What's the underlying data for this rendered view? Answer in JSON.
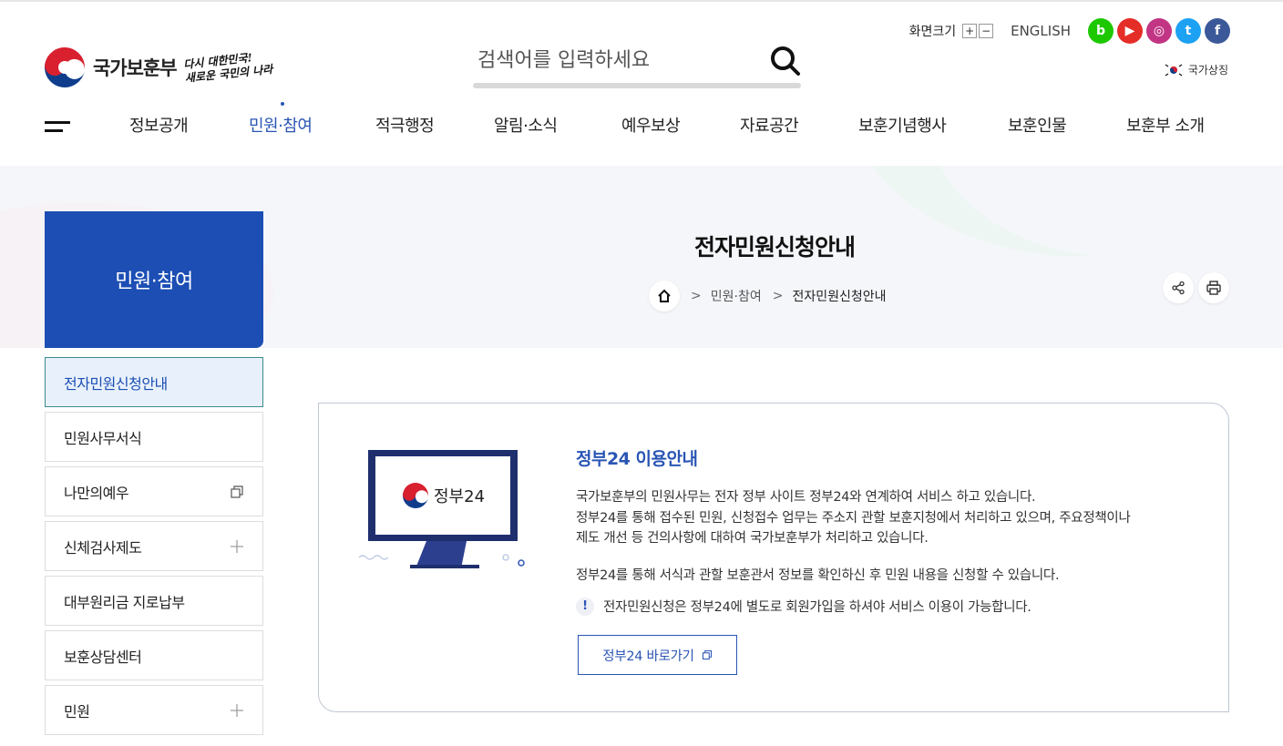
{
  "header": {
    "logo_text": "국가보훈부",
    "slogan_line1": "다시 대한민국!",
    "slogan_line2": "새로운 국민의 나라",
    "search_placeholder": "검색어를 입력하세요",
    "font_size_label": "화면크기",
    "font_plus": "+",
    "font_minus": "−",
    "english": "ENGLISH",
    "sns": [
      {
        "name": "blog",
        "glyph": "b",
        "color": "#1ec800"
      },
      {
        "name": "youtube",
        "glyph": "▶",
        "color": "#e52d27"
      },
      {
        "name": "instagram",
        "glyph": "◎",
        "color": "#c13584"
      },
      {
        "name": "twitter",
        "glyph": "t",
        "color": "#1da1f2"
      },
      {
        "name": "facebook",
        "glyph": "f",
        "color": "#3b5998"
      }
    ],
    "national_symbol": "국가상징"
  },
  "gnb": {
    "items": [
      "정보공개",
      "민원·참여",
      "적극행정",
      "알림·소식",
      "예우보상",
      "자료공간",
      "보훈기념행사",
      "보훈인물",
      "보훈부 소개"
    ],
    "active_index": 1
  },
  "side": {
    "title": "민원·참여",
    "items": [
      {
        "label": "전자민원신청안내",
        "mark": "none"
      },
      {
        "label": "민원사무서식",
        "mark": "none"
      },
      {
        "label": "나만의예우",
        "mark": "new-window"
      },
      {
        "label": "신체검사제도",
        "mark": "plus"
      },
      {
        "label": "대부원리금 지로납부",
        "mark": "none"
      },
      {
        "label": "보훈상담센터",
        "mark": "none"
      },
      {
        "label": "민원",
        "mark": "plus"
      }
    ]
  },
  "page": {
    "title": "전자민원신청안내",
    "breadcrumb": [
      "민원·참여",
      "전자민원신청안내"
    ]
  },
  "content": {
    "monitor_label": "정부24",
    "title": "정부24 이용안내",
    "desc_lines": [
      "국가보훈부의 민원사무는 전자 정부 사이트 정부24와 연계하여 서비스 하고 있습니다.",
      "정부24를 통해 접수된 민원, 신청접수 업무는 주소지 관할 보훈지청에서 처리하고 있으며, 주요정책이나",
      "제도 개선 등 건의사항에 대하여 국가보훈부가 처리하고 있습니다."
    ],
    "desc2": "정부24를 통해 서식과 관할 보훈관서 정보를 확인하신 후 민원 내용을 신청할 수 있습니다.",
    "notice_icon": "!",
    "notice": "전자민원신청은 정부24에 별도로 회원가입을 하셔야 서비스 이용이 가능합니다.",
    "button": "정부24 바로가기"
  },
  "colors": {
    "brand_blue": "#1c4eb4",
    "link_blue": "#2a55b4"
  }
}
